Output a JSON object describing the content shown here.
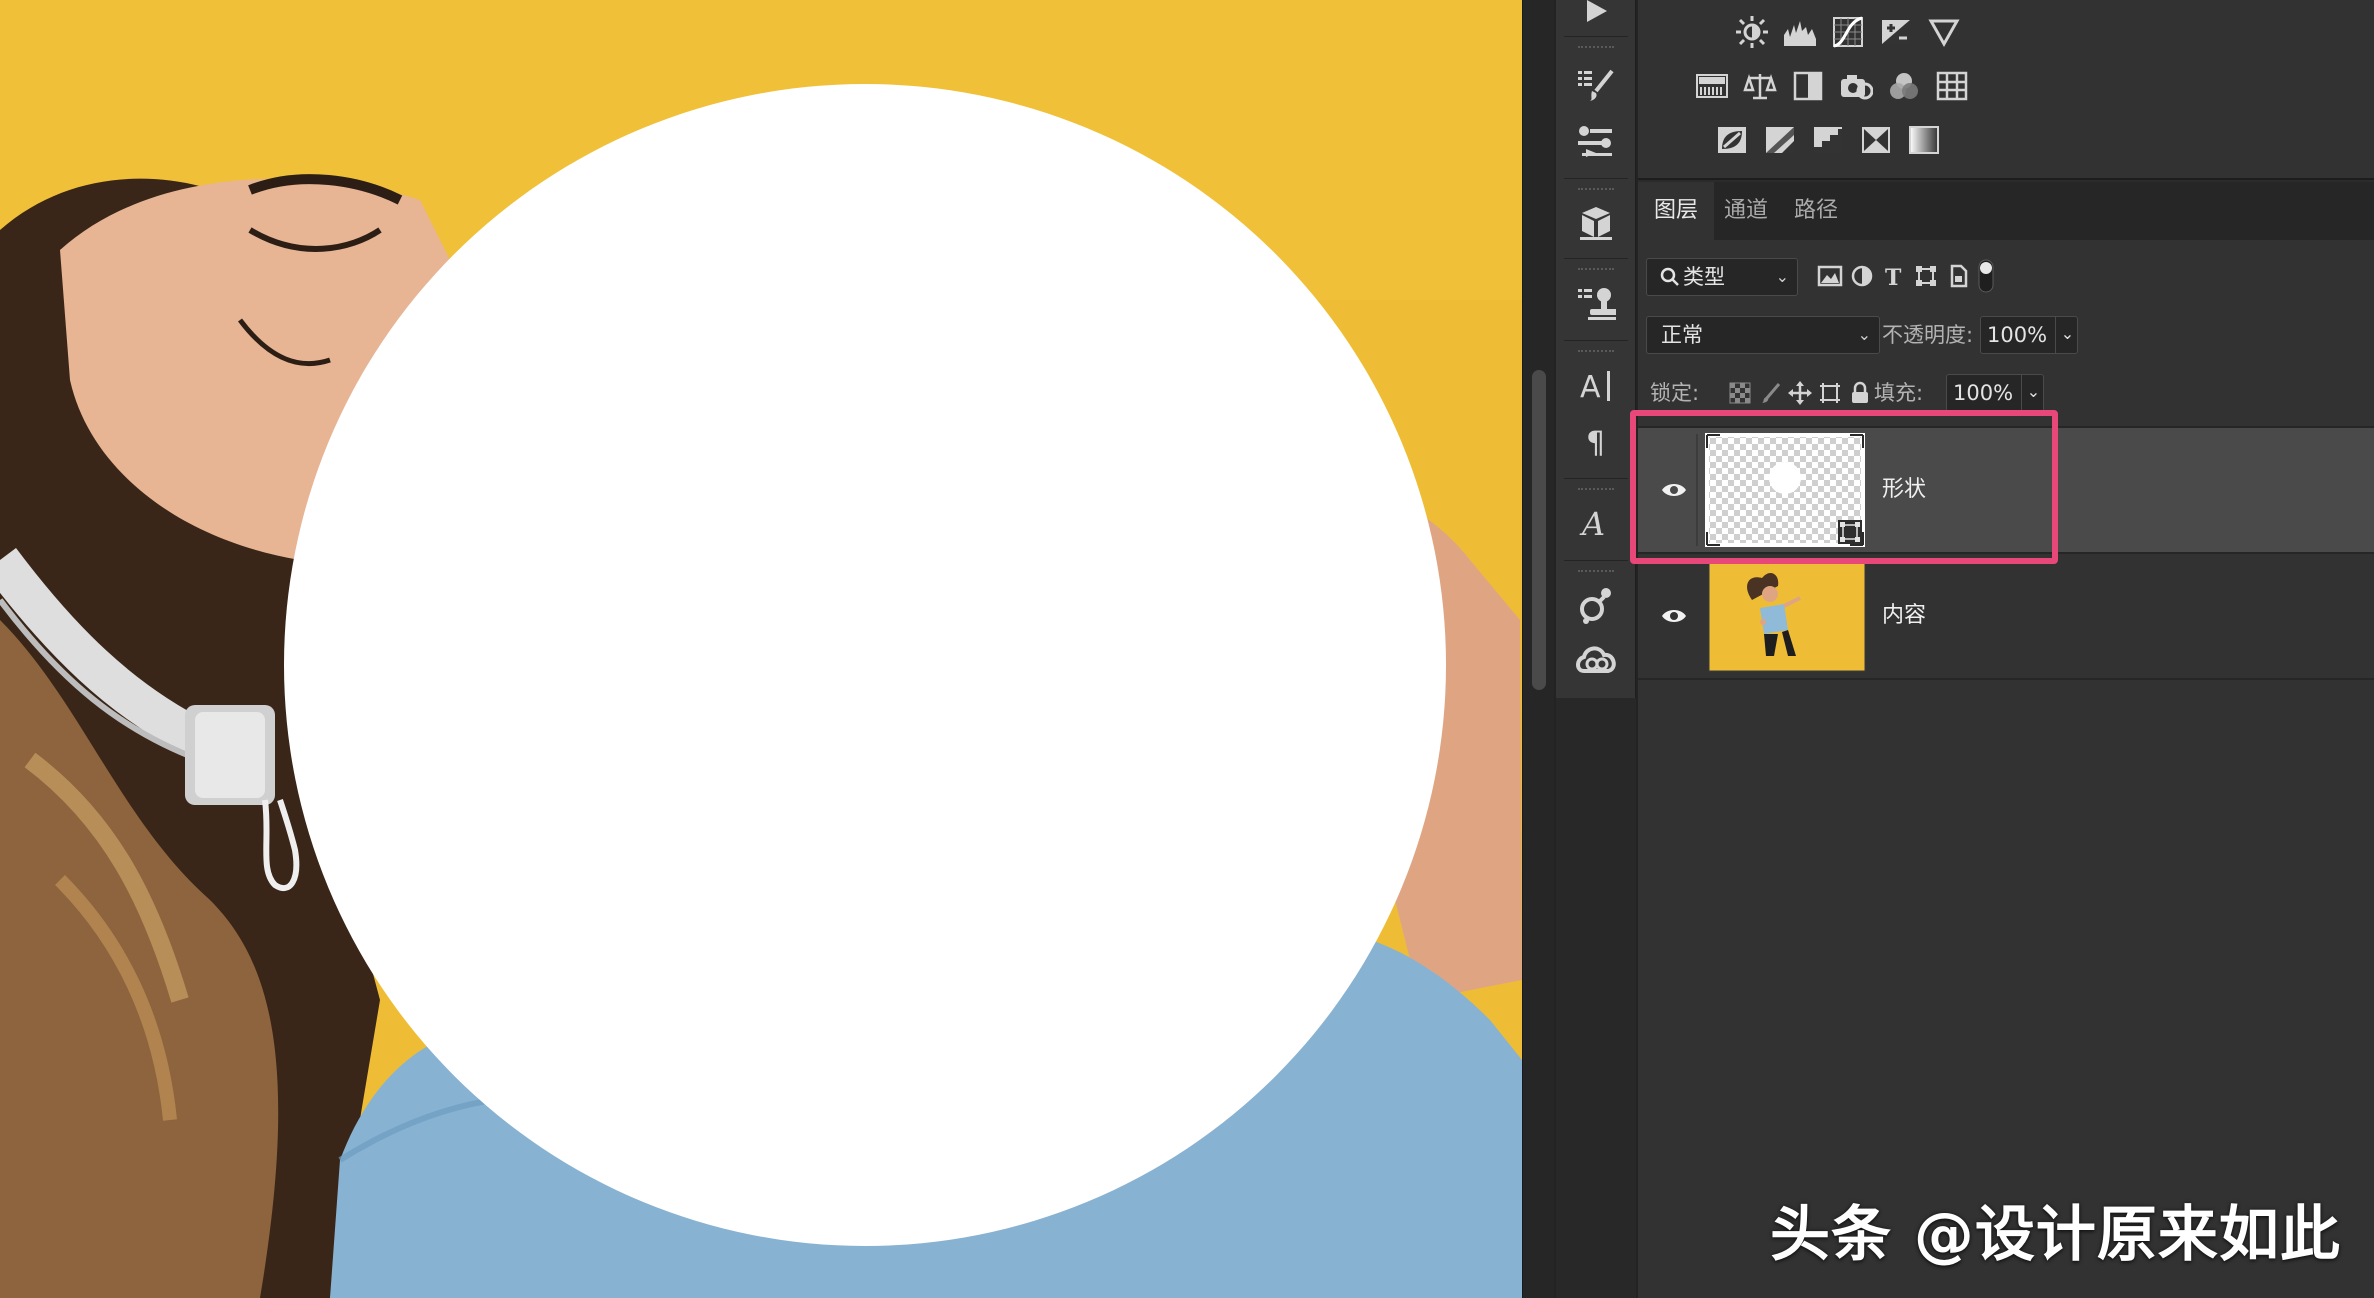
{
  "panel_tabs": [
    "图层",
    "通道",
    "路径"
  ],
  "active_tab": "图层",
  "filter": {
    "label": "类型",
    "icon": "search-icon"
  },
  "blend_mode": "正常",
  "opacity": {
    "label": "不透明度:",
    "value": "100%"
  },
  "lock_label": "锁定:",
  "fill": {
    "label": "填充:",
    "value": "100%"
  },
  "layers": [
    {
      "name": "形状",
      "selected": true,
      "visible": true,
      "thumbnail": "transparent-with-white-circle"
    },
    {
      "name": "内容",
      "selected": false,
      "visible": true,
      "thumbnail": "photo"
    }
  ],
  "watermark": "头条 @设计原来如此",
  "colors": {
    "canvas_background": "#efbd35",
    "shape_fill": "#ffffff",
    "highlight": "#e8477a",
    "panel_background": "#323232"
  },
  "adjustment_icons": [
    [
      "brightness-contrast-icon",
      "levels-icon",
      "curves-icon",
      "exposure-icon",
      "vibrance-icon"
    ],
    [
      "hue-saturation-icon",
      "color-balance-icon",
      "black-white-icon",
      "photo-filter-icon",
      "channel-mixer-icon",
      "color-lookup-icon"
    ],
    [
      "invert-icon",
      "posterize-icon",
      "threshold-icon",
      "selective-color-icon",
      "gradient-map-icon"
    ]
  ],
  "strip_icons": [
    "play-icon",
    "brush-presets-icon",
    "tool-presets-icon",
    "3d-icon",
    "clone-source-icon",
    "character-icon",
    "paragraph-icon",
    "glyphs-icon",
    "properties-icon",
    "creative-cloud-icon"
  ]
}
